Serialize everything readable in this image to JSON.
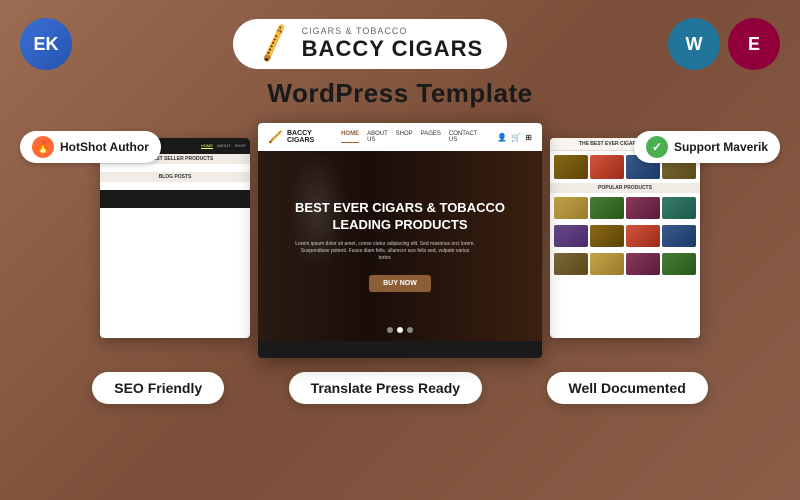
{
  "page": {
    "title": "WordPress Template",
    "background_color": "#8B5E4A"
  },
  "top_icons": {
    "ek_label": "EK",
    "wp_label": "W",
    "elementor_label": "E"
  },
  "logo": {
    "small_text": "CIGARS & TOBACCO",
    "big_text": "BACCY CIGARS"
  },
  "badges": {
    "hotshot": {
      "label": "HotShot Author",
      "icon": "🔥"
    },
    "support": {
      "label": "Support Maverik",
      "icon": "✓"
    }
  },
  "hero": {
    "title_line1": "BEST EVER CIGARS & TOBACCO",
    "title_line2": "LEADING PRODUCTS",
    "subtitle": "Lorem ipsum dolor sit amet, conse ctetur adipiscing elit. Sed maximus orci lorem. Suspendisse potenti. Fusce diam felis, ullamcor ace felis sed, vulpate varius tortor.",
    "button_label": "BUY NOW"
  },
  "nav": {
    "home": "HOME",
    "about": "ABOUT US",
    "shop": "SHOP",
    "pages": "PAGES",
    "contact": "CONTACT US"
  },
  "sections": {
    "best_seller": "OUR BEST SELLER PRODUCTS",
    "blog": "BLOG POSTS",
    "right_header": "THE BEST EVER CIGARS & TOBACCO",
    "popular": "POPULAR PRODUCTS"
  },
  "bottom_badges": {
    "seo": "SEO Friendly",
    "translate": "Translate Press Ready",
    "documented": "Well Documented"
  }
}
